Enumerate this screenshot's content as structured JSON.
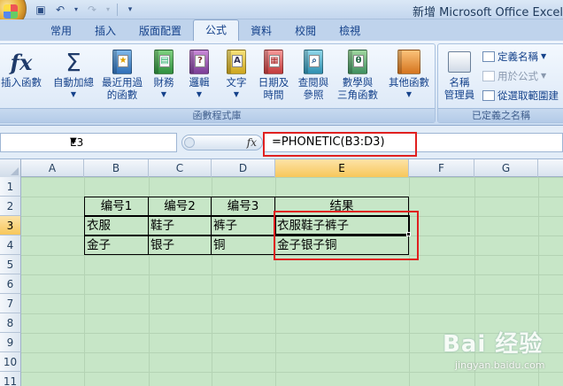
{
  "window": {
    "title": "新增 Microsoft Office Excel"
  },
  "tabs": [
    {
      "label": "常用"
    },
    {
      "label": "插入"
    },
    {
      "label": "版面配置"
    },
    {
      "label": "公式",
      "active": true
    },
    {
      "label": "資料"
    },
    {
      "label": "校閱"
    },
    {
      "label": "檢視"
    }
  ],
  "ribbon": {
    "insert_function": {
      "line1": "插入函數"
    },
    "autosum": {
      "line1": "自動加總"
    },
    "recent": {
      "line1": "最近用過",
      "line2": "的函數"
    },
    "financial": {
      "line1": "財務"
    },
    "logical": {
      "line1": "邏輯"
    },
    "text": {
      "line1": "文字"
    },
    "datetime": {
      "line1": "日期及",
      "line2": "時間"
    },
    "lookup": {
      "line1": "查閱與",
      "line2": "參照"
    },
    "math": {
      "line1": "數學與",
      "line2": "三角函數"
    },
    "more": {
      "line1": "其他函數"
    },
    "library_label": "函數程式庫",
    "name_manager": {
      "line1": "名稱",
      "line2": "管理員"
    },
    "define_name": "定義名稱",
    "use_in_formula": "用於公式",
    "create_from_selection": "從選取範圍建",
    "defined_names_label": "已定義之名稱"
  },
  "formula_bar": {
    "name_box": "E3",
    "fx": "fx",
    "formula": "=PHONETIC(B3:D3)"
  },
  "columns": [
    "A",
    "B",
    "C",
    "D",
    "E",
    "F",
    "G"
  ],
  "rows": [
    "1",
    "2",
    "3",
    "4",
    "5",
    "6",
    "7",
    "8",
    "9",
    "10",
    "11"
  ],
  "selected": {
    "column": "E",
    "row": "3"
  },
  "table": {
    "headers": [
      "编号1",
      "编号2",
      "编号3",
      "结果"
    ],
    "rows": [
      [
        "衣服",
        "鞋子",
        "裤子",
        "衣服鞋子裤子"
      ],
      [
        "金子",
        "银子",
        "铜",
        "金子银子铜"
      ]
    ]
  },
  "watermark": {
    "brand": "Bai 经验",
    "site": "jingyan.baidu.com"
  },
  "colors": {
    "sheet_background": "#c7e6c7",
    "highlight": "#e02020",
    "selected_header": "#f7c75b"
  }
}
